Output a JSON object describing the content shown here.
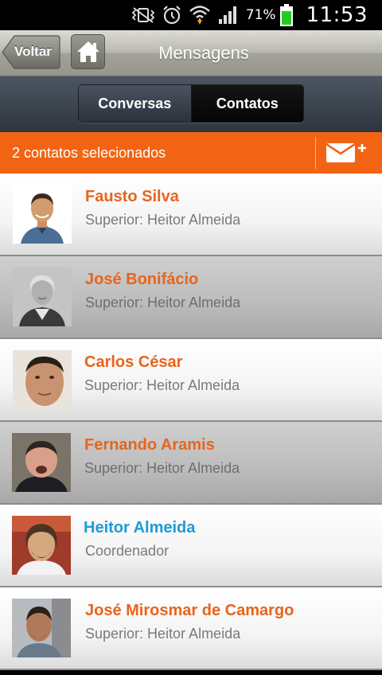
{
  "status_bar": {
    "battery_percent": "71%",
    "time": "11:53",
    "icons": [
      "vibrate-icon",
      "alarm-icon",
      "wifi-icon",
      "signal-icon",
      "battery-icon"
    ]
  },
  "header": {
    "back_label": "Voltar",
    "home_icon": "home-icon",
    "title": "Mensagens"
  },
  "tabs": [
    {
      "label": "Conversas",
      "active": false
    },
    {
      "label": "Contatos",
      "active": true
    }
  ],
  "selection_bar": {
    "text": "2 contatos selecionados",
    "action_icon": "mail-add-icon"
  },
  "contacts": [
    {
      "name": "Fausto Silva",
      "subtitle": "Superior: Heitor Almeida",
      "selected": false,
      "highlight": false
    },
    {
      "name": "José Bonifácio",
      "subtitle": "Superior: Heitor Almeida",
      "selected": true,
      "highlight": false
    },
    {
      "name": "Carlos César",
      "subtitle": "Superior: Heitor Almeida",
      "selected": false,
      "highlight": false
    },
    {
      "name": "Fernando Aramis",
      "subtitle": "Superior: Heitor Almeida",
      "selected": true,
      "highlight": false
    },
    {
      "name": "Heitor Almeida",
      "subtitle": "Coordenador",
      "selected": false,
      "highlight": true
    },
    {
      "name": "José Mirosmar de Camargo",
      "subtitle": "Superior: Heitor Almeida",
      "selected": false,
      "highlight": false
    }
  ],
  "colors": {
    "accent_orange": "#f26414",
    "name_orange": "#e8641e",
    "name_blue": "#1e9ad6",
    "subtitle_gray": "#7a7a7a"
  }
}
